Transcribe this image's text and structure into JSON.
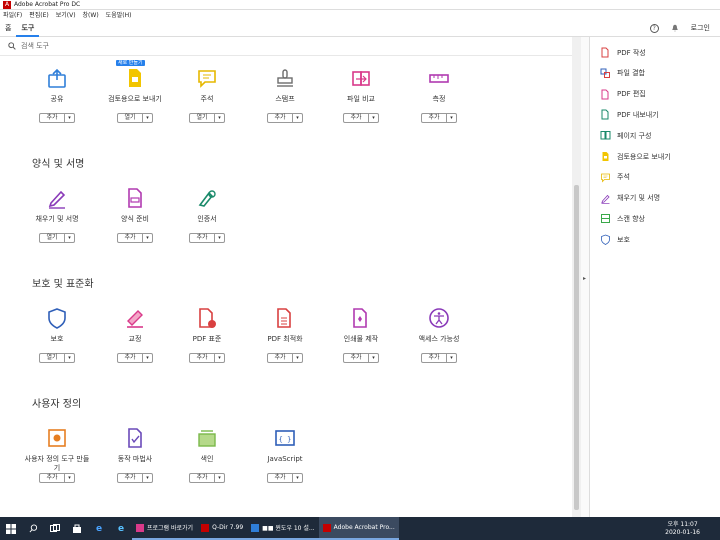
{
  "window": {
    "title": "Adobe Acrobat Pro DC"
  },
  "menu": [
    "파일(F)",
    "편집(E)",
    "보기(V)",
    "창(W)",
    "도움말(H)"
  ],
  "tabs": [
    {
      "label": "홈"
    },
    {
      "label": "도구"
    }
  ],
  "header": {
    "help_icon": "?",
    "login": "로그인"
  },
  "search": {
    "placeholder": "검색 도구"
  },
  "sections": [
    {
      "title": "",
      "tools": [
        {
          "label": "공유",
          "button": "추가",
          "icon": "share-icon",
          "color": "#2f7ed8"
        },
        {
          "label": "검토용으로 보내기",
          "button": "열기",
          "icon": "send-for-review-icon",
          "color": "#e6b800",
          "badge": "새로 만들기"
        },
        {
          "label": "주석",
          "button": "열기",
          "icon": "comment-icon",
          "color": "#e6b800"
        },
        {
          "label": "스탬프",
          "button": "추가",
          "icon": "stamp-icon",
          "color": "#6d6d6d"
        },
        {
          "label": "파일 비교",
          "button": "추가",
          "icon": "compare-files-icon",
          "color": "#d93a8a"
        },
        {
          "label": "측정",
          "button": "추가",
          "icon": "measure-icon",
          "color": "#b13ab1"
        }
      ]
    },
    {
      "title": "양식 및 서명",
      "tools": [
        {
          "label": "채우기 및 서명",
          "button": "열기",
          "icon": "fill-sign-icon",
          "color": "#8a3ab9"
        },
        {
          "label": "양식 준비",
          "button": "추가",
          "icon": "prepare-form-icon",
          "color": "#b13ab1"
        },
        {
          "label": "인증서",
          "button": "추가",
          "icon": "certificates-icon",
          "color": "#1a8a6a"
        }
      ]
    },
    {
      "title": "보호 및 표준화",
      "tools": [
        {
          "label": "보호",
          "button": "열기",
          "icon": "protect-icon",
          "color": "#2f5fb8"
        },
        {
          "label": "교정",
          "button": "추가",
          "icon": "redact-icon",
          "color": "#d93a8a"
        },
        {
          "label": "PDF 표준",
          "button": "추가",
          "icon": "pdf-standards-icon",
          "color": "#d94040"
        },
        {
          "label": "PDF 최적화",
          "button": "추가",
          "icon": "optimize-pdf-icon",
          "color": "#d94040"
        },
        {
          "label": "인쇄물 제작",
          "button": "추가",
          "icon": "print-production-icon",
          "color": "#b13ab1"
        },
        {
          "label": "액세스 가능성",
          "button": "추가",
          "icon": "accessibility-icon",
          "color": "#8a3ab9"
        }
      ]
    },
    {
      "title": "사용자 정의",
      "tools": [
        {
          "label": "사용자 정의 도구 만들기",
          "button": "추가",
          "icon": "custom-tool-icon",
          "color": "#e67e22"
        },
        {
          "label": "동작 마법사",
          "button": "추가",
          "icon": "action-wizard-icon",
          "color": "#6a4ab9"
        },
        {
          "label": "색인",
          "button": "추가",
          "icon": "index-icon",
          "color": "#7ab84a"
        },
        {
          "label": "JavaScript",
          "button": "추가",
          "icon": "javascript-icon",
          "color": "#2f5fb8"
        }
      ]
    }
  ],
  "right_pane": [
    {
      "label": "PDF 작성",
      "icon": "create-pdf-icon",
      "color": "#d94040"
    },
    {
      "label": "파일 결합",
      "icon": "combine-files-icon",
      "color": "#2f5fb8"
    },
    {
      "label": "PDF 편집",
      "icon": "edit-pdf-icon",
      "color": "#d93a8a"
    },
    {
      "label": "PDF 내보내기",
      "icon": "export-pdf-icon",
      "color": "#1a8a6a"
    },
    {
      "label": "페이지 구성",
      "icon": "organize-pages-icon",
      "color": "#1a8a6a"
    },
    {
      "label": "검토용으로 보내기",
      "icon": "send-for-review-icon",
      "color": "#e6b800"
    },
    {
      "label": "주석",
      "icon": "comment-icon",
      "color": "#e6b800"
    },
    {
      "label": "채우기 및 서명",
      "icon": "fill-sign-icon",
      "color": "#8a3ab9"
    },
    {
      "label": "스캔 향상",
      "icon": "enhance-scans-icon",
      "color": "#3aa84a"
    },
    {
      "label": "보호",
      "icon": "protect-icon",
      "color": "#2f5fb8"
    }
  ],
  "taskbar": {
    "tasks": [
      {
        "label": "프로그램 바로가기",
        "color": "#d93a8a"
      },
      {
        "label": "Q-Dir 7.99",
        "color": "#c40000"
      },
      {
        "label": "■■ 윈도우 10 설...",
        "color": "#2f7ed8"
      },
      {
        "label": "Adobe Acrobat Pro...",
        "color": "#c40000",
        "active": true
      }
    ],
    "clock": {
      "time": "오후 11:07",
      "date": "2020-01-16"
    }
  }
}
